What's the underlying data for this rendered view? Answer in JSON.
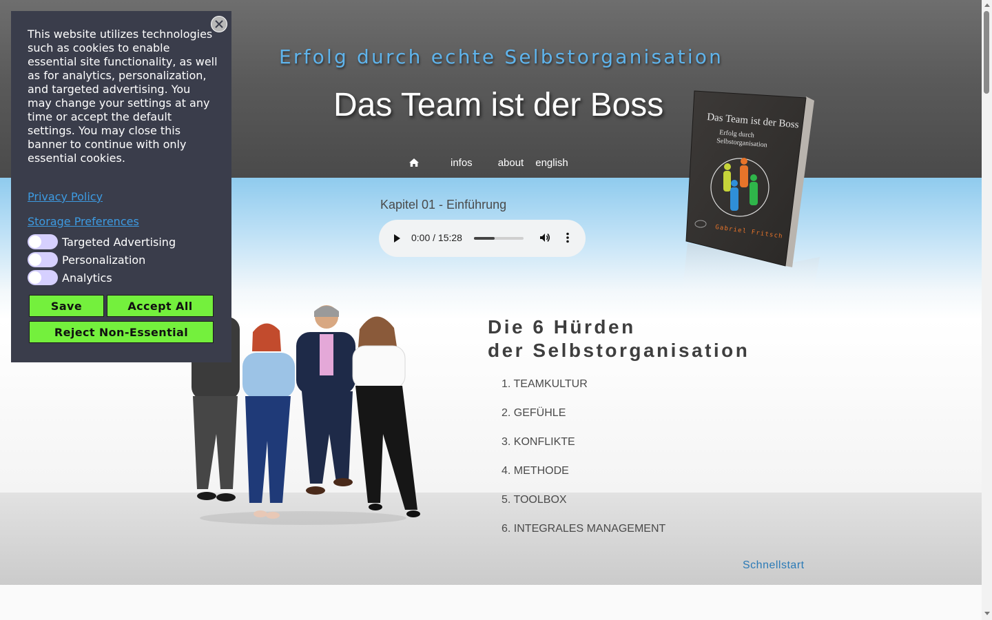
{
  "header": {
    "tagline": "Erfolg durch echte Selbstorganisation",
    "title": "Das Team ist der Boss",
    "nav": {
      "home_icon": "home-icon",
      "items": [
        {
          "label": "infos"
        },
        {
          "label": "about"
        },
        {
          "label": "english"
        }
      ]
    }
  },
  "book": {
    "title": "Das Team ist der Boss",
    "subtitle_line1": "Erfolg durch",
    "subtitle_line2": "Selbstorganisation",
    "author": "Gabriel Fritsch"
  },
  "audio": {
    "chapter": "Kapitel 01 - Einführung",
    "time": "0:00 / 15:28",
    "volume_level": 0.42,
    "icons": [
      "play-icon",
      "volume-icon",
      "more-options-icon"
    ]
  },
  "main": {
    "heading_line1": "Die 6 Hürden",
    "heading_line2": "der Selbstorganisation",
    "hurdles": [
      "1. TEAMKULTUR",
      "2. GEFÜHLE",
      "3. KONFLIKTE",
      "4. METHODE",
      "5. TOOLBOX",
      "6. INTEGRALES MANAGEMENT"
    ],
    "quickstart_label": "Schnellstart"
  },
  "cookie_banner": {
    "text": "This website utilizes technologies such as cookies to enable essential site functionality, as well as for analytics, personalization, and targeted advertising. You may change your settings at any time or accept the default settings. You may close this banner to continue with only essential cookies.",
    "privacy_link": "Privacy Policy",
    "storage_link": "Storage Preferences",
    "toggles": [
      {
        "label": "Targeted Advertising",
        "enabled": false
      },
      {
        "label": "Personalization",
        "enabled": false
      },
      {
        "label": "Analytics",
        "enabled": false
      }
    ],
    "buttons": {
      "save": "Save",
      "accept_all": "Accept All",
      "reject": "Reject Non-Essential"
    },
    "colors": {
      "background": "#3a3d4b",
      "button": "#74f03d",
      "link": "#3d9be2",
      "toggle_off": "#d6d0ff"
    }
  }
}
